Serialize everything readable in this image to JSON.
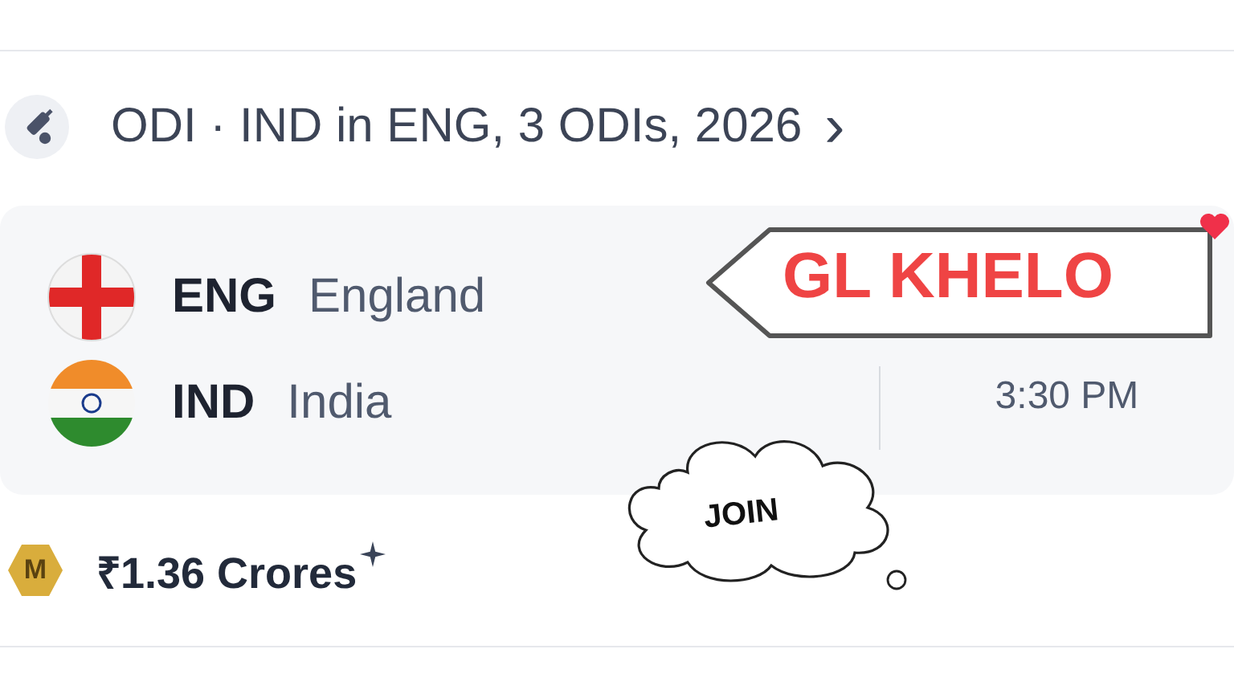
{
  "match_card": {
    "header": {
      "title": "ODI · IND in ENG, 3 ODIs, 2026",
      "chevron": "›"
    },
    "teams": [
      {
        "code": "ENG",
        "name": "England",
        "kind": "eng"
      },
      {
        "code": "IND",
        "name": "India",
        "kind": "ind"
      }
    ],
    "start_time": "3:30 PM",
    "prize": {
      "badge_letter": "M",
      "amount": "₹1.36 Crores"
    }
  },
  "overlays": {
    "sign": {
      "text": "GL KHELO"
    },
    "cloud": {
      "text": "JOIN"
    }
  }
}
